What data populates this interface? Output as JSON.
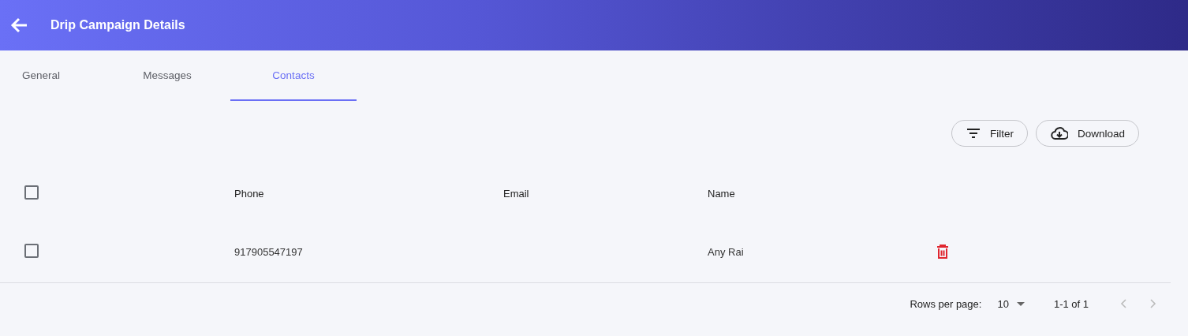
{
  "header": {
    "title": "Drip Campaign Details"
  },
  "tabs": [
    {
      "label": "General",
      "selected": false
    },
    {
      "label": "Messages",
      "selected": false
    },
    {
      "label": "Contacts",
      "selected": true
    }
  ],
  "toolbar": [
    "Filter",
    "Download"
  ],
  "table": {
    "select_all": {
      "checked": false
    },
    "columns": [
      "Phone",
      "Email",
      "Name"
    ],
    "rows": [
      {
        "checked": false,
        "cells": [
          "917905547197",
          "",
          "Any Rai"
        ]
      }
    ]
  },
  "pagination": {
    "rows_per_page_label": "Rows per page:",
    "rows_per_page": "10",
    "range": "1-1 of 1"
  }
}
